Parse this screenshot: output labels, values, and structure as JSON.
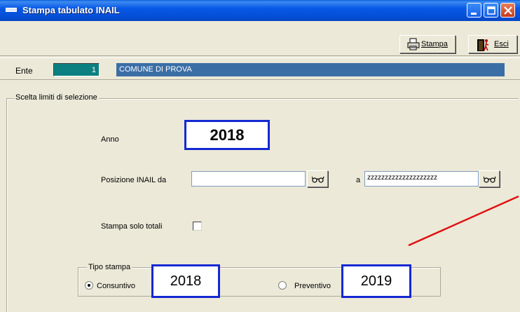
{
  "window": {
    "title": "Stampa tabulato INAIL",
    "controls": [
      "minimize-icon",
      "maximize-icon",
      "close-icon"
    ]
  },
  "toolbar": {
    "stampa_label": "Stampa",
    "esci_label": "Esci"
  },
  "ente": {
    "label": "Ente",
    "code": "1",
    "name": "COMUNE DI PROVA"
  },
  "selection": {
    "group_label": "Scelta limiti di selezione",
    "anno_label": "Anno",
    "anno_value": "2018",
    "posizione_label": "Posizione INAIL da",
    "posizione_from": "",
    "a_label": "a",
    "posizione_to": "zzzzzzzzzzzzzzzzzzzz",
    "solo_totali_label": "Stampa solo totali",
    "solo_totali_checked": false
  },
  "tipo_stampa": {
    "group_label": "Tipo stampa",
    "consuntivo_label": "Consuntivo",
    "consuntivo_year": "2018",
    "preventivo_label": "Preventivo",
    "preventivo_year": "2019",
    "selected": "Consuntivo"
  },
  "colors": {
    "title_bar": "#0550d8",
    "ente_code_bg": "#0c8080",
    "ente_name_bg": "#3a6ea5",
    "annotation_border": "#1428d2",
    "annotation_arrow": "#e01010"
  }
}
